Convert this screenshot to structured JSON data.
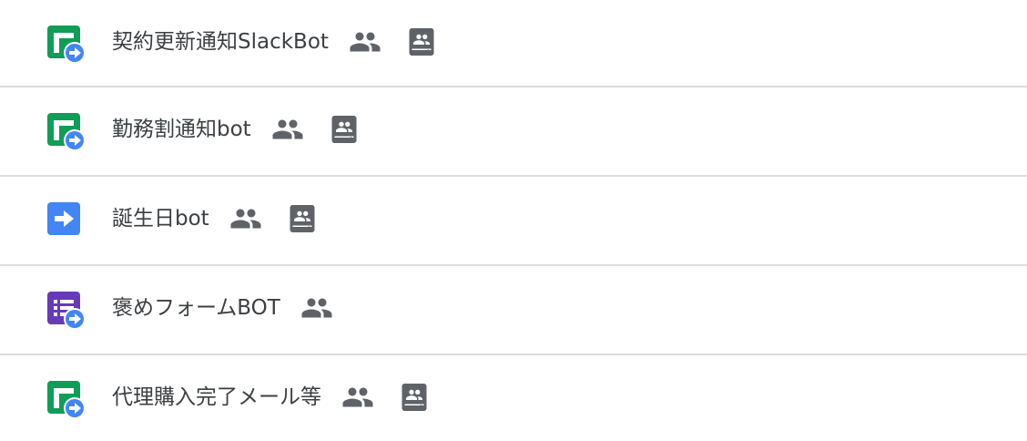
{
  "colors": {
    "sheets_green": "#0f9d58",
    "script_blue": "#4285f4",
    "forms_purple": "#673ab7",
    "icon_gray": "#5f6368",
    "divider": "#dadce0",
    "text": "#3c4043"
  },
  "items": [
    {
      "title": "契約更新通知SlackBot",
      "app_icon": "sheets-script-icon",
      "shared_icon": "people-icon",
      "drive_icon": "shared-drive-icon"
    },
    {
      "title": "勤務割通知bot",
      "app_icon": "sheets-script-icon",
      "shared_icon": "people-icon",
      "drive_icon": "shared-drive-icon"
    },
    {
      "title": "誕生日bot",
      "app_icon": "apps-script-icon",
      "shared_icon": "people-icon",
      "drive_icon": "shared-drive-icon"
    },
    {
      "title": "褒めフォームBOT",
      "app_icon": "forms-script-icon",
      "shared_icon": "people-icon"
    },
    {
      "title": "代理購入完了メール等",
      "app_icon": "sheets-script-icon",
      "shared_icon": "people-icon",
      "drive_icon": "shared-drive-icon"
    }
  ]
}
